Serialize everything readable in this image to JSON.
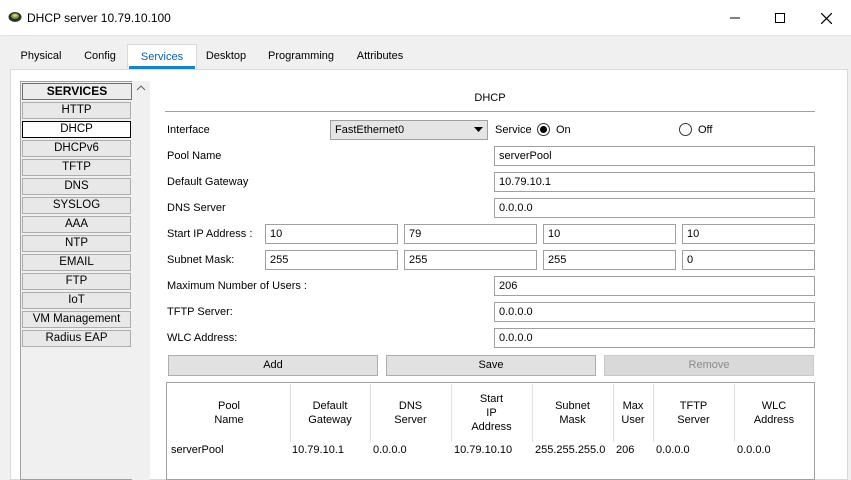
{
  "window": {
    "title": "DHCP server 10.79.10.100"
  },
  "tabs": [
    {
      "label": "Physical"
    },
    {
      "label": "Config"
    },
    {
      "label": "Services"
    },
    {
      "label": "Desktop"
    },
    {
      "label": "Programming"
    },
    {
      "label": "Attributes"
    }
  ],
  "sidebar": {
    "header": "SERVICES",
    "items": [
      {
        "label": "HTTP"
      },
      {
        "label": "DHCP"
      },
      {
        "label": "DHCPv6"
      },
      {
        "label": "TFTP"
      },
      {
        "label": "DNS"
      },
      {
        "label": "SYSLOG"
      },
      {
        "label": "AAA"
      },
      {
        "label": "NTP"
      },
      {
        "label": "EMAIL"
      },
      {
        "label": "FTP"
      },
      {
        "label": "IoT"
      },
      {
        "label": "VM Management"
      },
      {
        "label": "Radius EAP"
      }
    ]
  },
  "dhcp": {
    "title": "DHCP",
    "interface_label": "Interface",
    "interface_value": "FastEthernet0",
    "service_label": "Service",
    "on_label": "On",
    "off_label": "Off",
    "pool_name_label": "Pool Name",
    "pool_name": "serverPool",
    "gateway_label": "Default Gateway",
    "gateway": "10.79.10.1",
    "dns_label": "DNS Server",
    "dns": "0.0.0.0",
    "start_ip_label": "Start IP Address :",
    "start_ip": [
      "10",
      "79",
      "10",
      "10"
    ],
    "mask_label": "Subnet Mask:",
    "mask": [
      "255",
      "255",
      "255",
      "0"
    ],
    "max_users_label": "Maximum Number of Users :",
    "max_users": "206",
    "tftp_label": "TFTP Server:",
    "tftp": "0.0.0.0",
    "wlc_label": "WLC Address:",
    "wlc": "0.0.0.0",
    "add_label": "Add",
    "save_label": "Save",
    "remove_label": "Remove"
  },
  "table": {
    "headers": [
      "Pool\nName",
      "Default\nGateway",
      "DNS\nServer",
      "Start\nIP\nAddress",
      "Subnet\nMask",
      "Max\nUser",
      "TFTP\nServer",
      "WLC\nAddress"
    ],
    "rows": [
      [
        "serverPool",
        "10.79.10.1",
        "0.0.0.0",
        "10.79.10.10",
        "255.255.255.0",
        "206",
        "0.0.0.0",
        "0.0.0.0"
      ]
    ]
  },
  "colors": {
    "accent": "#1a83c7",
    "active_tab_text": "#0a5fa6"
  },
  "icons": {
    "app": "packet-tracer-icon",
    "minimize": "minimize-icon",
    "maximize": "maximize-icon",
    "close": "close-icon",
    "dropdown": "chevron-down-icon",
    "scroll_up": "scroll-up-arrow-icon"
  }
}
